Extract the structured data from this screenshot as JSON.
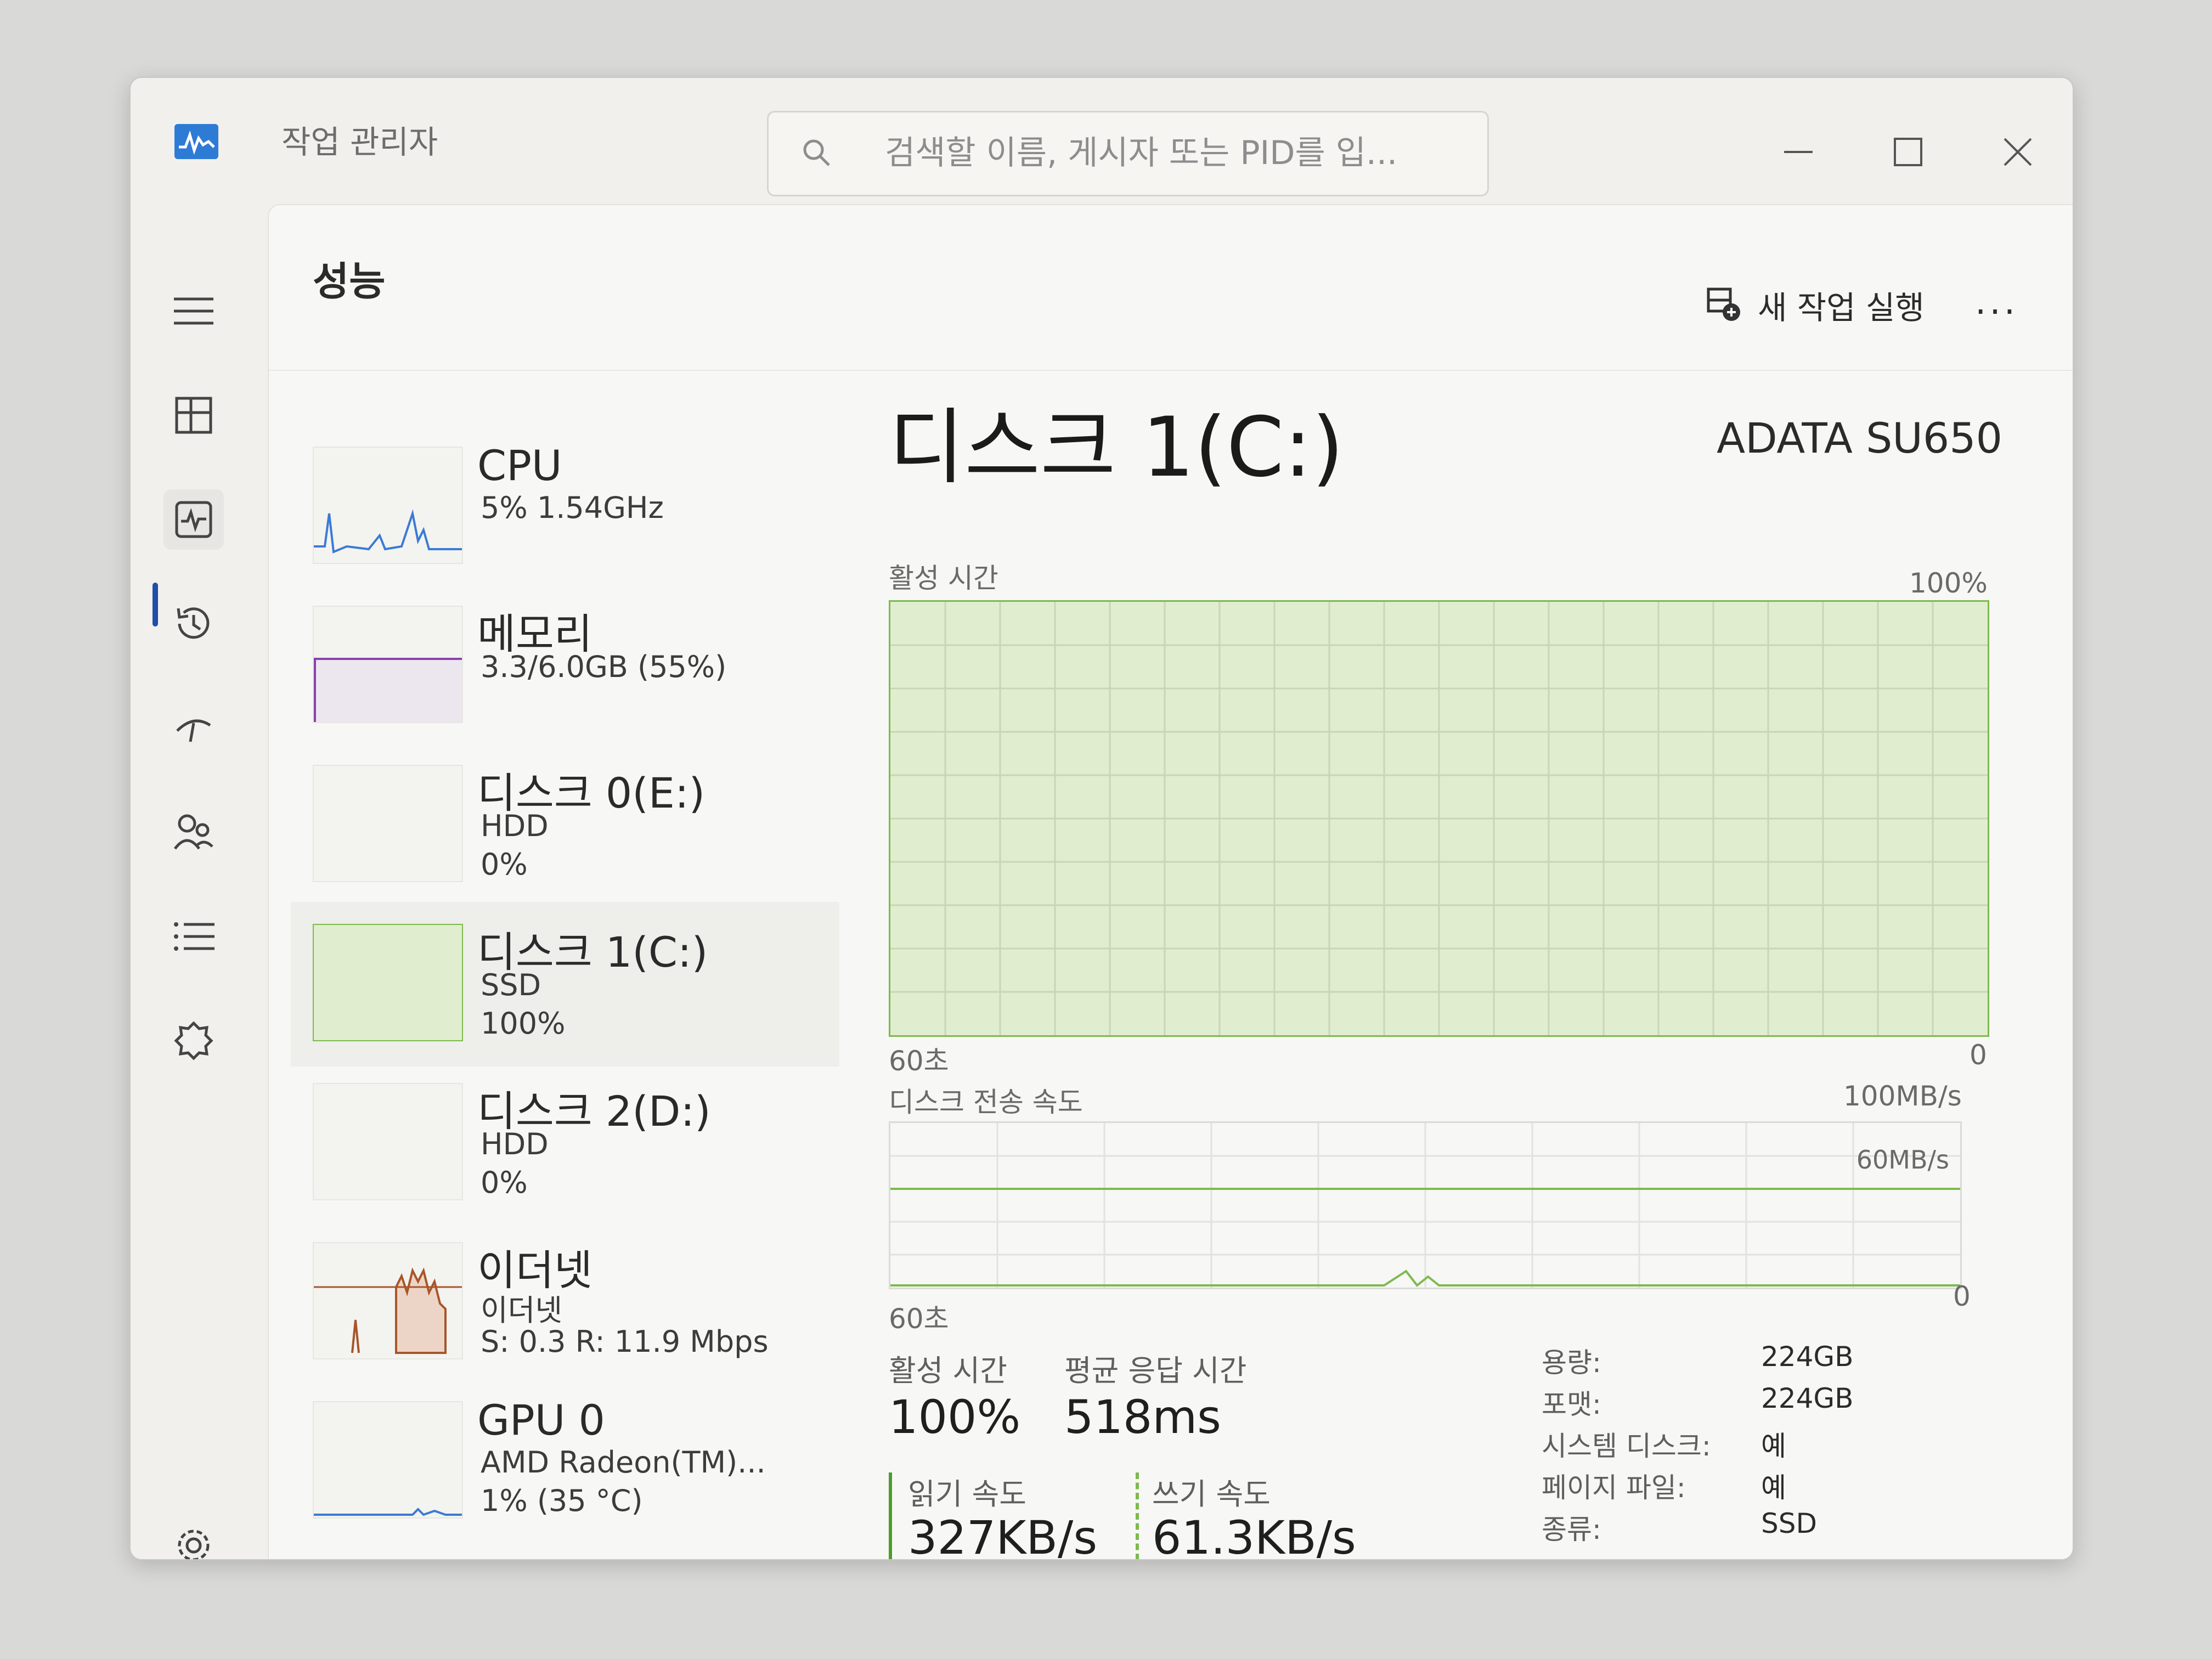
{
  "app": {
    "title": "작업 관리자"
  },
  "search": {
    "placeholder": "검색할 이름, 게시자 또는 PID를 입..."
  },
  "page": {
    "title": "성능",
    "run_new_task": "새 작업 실행",
    "more": "..."
  },
  "devices": [
    {
      "name": "CPU",
      "line1": "5% 1.54GHz",
      "line2": ""
    },
    {
      "name": "메모리",
      "line1": "3.3/6.0GB (55%)",
      "line2": ""
    },
    {
      "name": "디스크 0(E:)",
      "line1": "HDD",
      "line2": "0%"
    },
    {
      "name": "디스크 1(C:)",
      "line1": "SSD",
      "line2": "100%"
    },
    {
      "name": "디스크 2(D:)",
      "line1": "HDD",
      "line2": "0%"
    },
    {
      "name": "이더넷",
      "line1": "이더넷",
      "line2": "S: 0.3 R: 11.9 Mbps"
    },
    {
      "name": "GPU 0",
      "line1": "AMD Radeon(TM)...",
      "line2": "1% (35 °C)"
    }
  ],
  "detail": {
    "title": "디스크 1(C:)",
    "model": "ADATA SU650",
    "graph1": {
      "label": "활성 시간",
      "max": "100%",
      "time": "60초",
      "min": "0",
      "value_percent": 100
    },
    "graph2": {
      "label": "디스크 전송 속도",
      "max": "100MB/s",
      "line_label": "60MB/s",
      "time": "60초",
      "min": "0"
    },
    "stats": {
      "active_time_label": "활성 시간",
      "active_time": "100%",
      "avg_response_label": "평균 응답 시간",
      "avg_response": "518ms",
      "read_label": "읽기 속도",
      "read": "327KB/s",
      "write_label": "쓰기 속도",
      "write": "61.3KB/s"
    },
    "props": [
      {
        "key": "용량:",
        "value": "224GB"
      },
      {
        "key": "포맷:",
        "value": "224GB"
      },
      {
        "key": "시스템 디스크:",
        "value": "예"
      },
      {
        "key": "페이지 파일:",
        "value": "예"
      },
      {
        "key": "종류:",
        "value": "SSD"
      }
    ]
  },
  "colors": {
    "disk_green": "#7eba4f",
    "cpu_blue": "#3a7bd5",
    "mem_purple": "#8a3fb0",
    "eth_brown": "#a8552a",
    "accent": "#1f4fa8"
  },
  "icons": [
    "app-performance-icon",
    "search-icon",
    "minimize-icon",
    "maximize-icon",
    "close-icon",
    "hamburger-icon",
    "processes-icon",
    "performance-icon",
    "history-icon",
    "startup-icon",
    "users-icon",
    "details-icon",
    "services-icon",
    "settings-icon",
    "new-task-icon"
  ]
}
